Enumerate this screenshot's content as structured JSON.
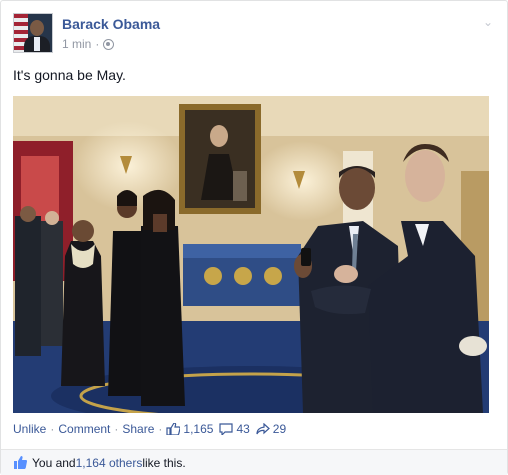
{
  "post": {
    "author": "Barack Obama",
    "timestamp": "1 min",
    "separator": "·",
    "status_text": "It's gonna be May."
  },
  "photo": {
    "description_icon": "photo-icon"
  },
  "actions": {
    "unlike_label": "Unlike",
    "comment_label": "Comment",
    "share_label": "Share",
    "dot": "·",
    "like_count": "1,165",
    "comment_count": "43",
    "share_count": "29"
  },
  "likes": {
    "prefix": "You and ",
    "others_link": "1,164 others",
    "suffix": " like this."
  },
  "colors": {
    "link": "#3b5998",
    "muted": "#9197a3",
    "text": "#141823"
  },
  "icons": [
    "globe-icon",
    "chevron-down-icon",
    "thumbs-up-icon",
    "comment-icon",
    "share-icon"
  ]
}
